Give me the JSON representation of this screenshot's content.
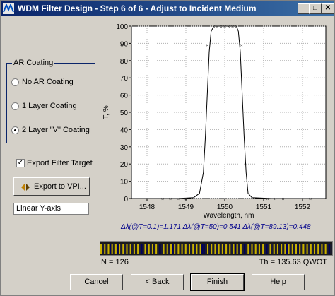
{
  "window": {
    "title": "WDM Filter Design - Step 6 of 6 - Adjust to Incident Medium"
  },
  "titlebar_buttons": {
    "minimize": "_",
    "maximize": "□",
    "close": "✕"
  },
  "ar_coating": {
    "label": "AR Coating",
    "options": [
      {
        "label": "No AR Coating",
        "checked": false
      },
      {
        "label": "1 Layer Coating",
        "checked": false
      },
      {
        "label": "2 Layer \"V\" Coating",
        "checked": true
      }
    ]
  },
  "export_filter_target": {
    "label": "Export Filter Target",
    "checked": true
  },
  "export_vpi_label": "Export to VPI...",
  "axis_mode": "Linear Y-axis",
  "chart_data": {
    "type": "line",
    "xlabel": "Wavelength, nm",
    "ylabel": "T, %",
    "xlim": [
      1547.6,
      1552.6
    ],
    "ylim": [
      0,
      100
    ],
    "xticks": [
      1548,
      1549,
      1550,
      1551,
      1552
    ],
    "yticks": [
      0,
      10,
      20,
      30,
      40,
      50,
      60,
      70,
      80,
      90,
      100
    ],
    "grid": true,
    "series": [
      {
        "x": [
          1547.6,
          1548.8,
          1549.2,
          1549.35,
          1549.45,
          1549.5,
          1549.55,
          1549.6,
          1549.65,
          1549.72,
          1549.8,
          1550.0,
          1550.2,
          1550.3,
          1550.35,
          1550.4,
          1550.45,
          1550.5,
          1550.55,
          1550.6,
          1550.7,
          1551.2,
          1552.6
        ],
        "y": [
          0,
          0,
          0.5,
          3,
          15,
          35,
          60,
          85,
          97,
          100,
          100,
          100,
          100,
          100,
          97,
          85,
          60,
          35,
          15,
          3,
          0.5,
          0,
          0
        ]
      }
    ],
    "target_marks": {
      "x": [
        1548.4,
        1548.6,
        1548.8,
        1549.0,
        1549.55,
        1549.72,
        1549.8,
        1549.9,
        1550.0,
        1550.1,
        1550.2,
        1550.3,
        1550.43,
        1551.1,
        1551.3,
        1551.5,
        1552.2
      ],
      "y": [
        0,
        0,
        0,
        0,
        89.13,
        100,
        100,
        100,
        100,
        100,
        100,
        100,
        89.13,
        0,
        0,
        0,
        0
      ]
    }
  },
  "bandwidths": "Δλ(@T=0.1)=1.171  Δλ(@T=50)=0.541  Δλ(@T=89.13)=0.448",
  "layers": {
    "n_label": "N = 126",
    "th_label": "Th = 135.63 QWOT",
    "colors": {
      "low": "#c9b100",
      "high": "#1a1a3a",
      "accent": "#000060"
    }
  },
  "buttons": {
    "cancel": "Cancel",
    "back": "< Back",
    "finish": "Finish",
    "help": "Help"
  }
}
